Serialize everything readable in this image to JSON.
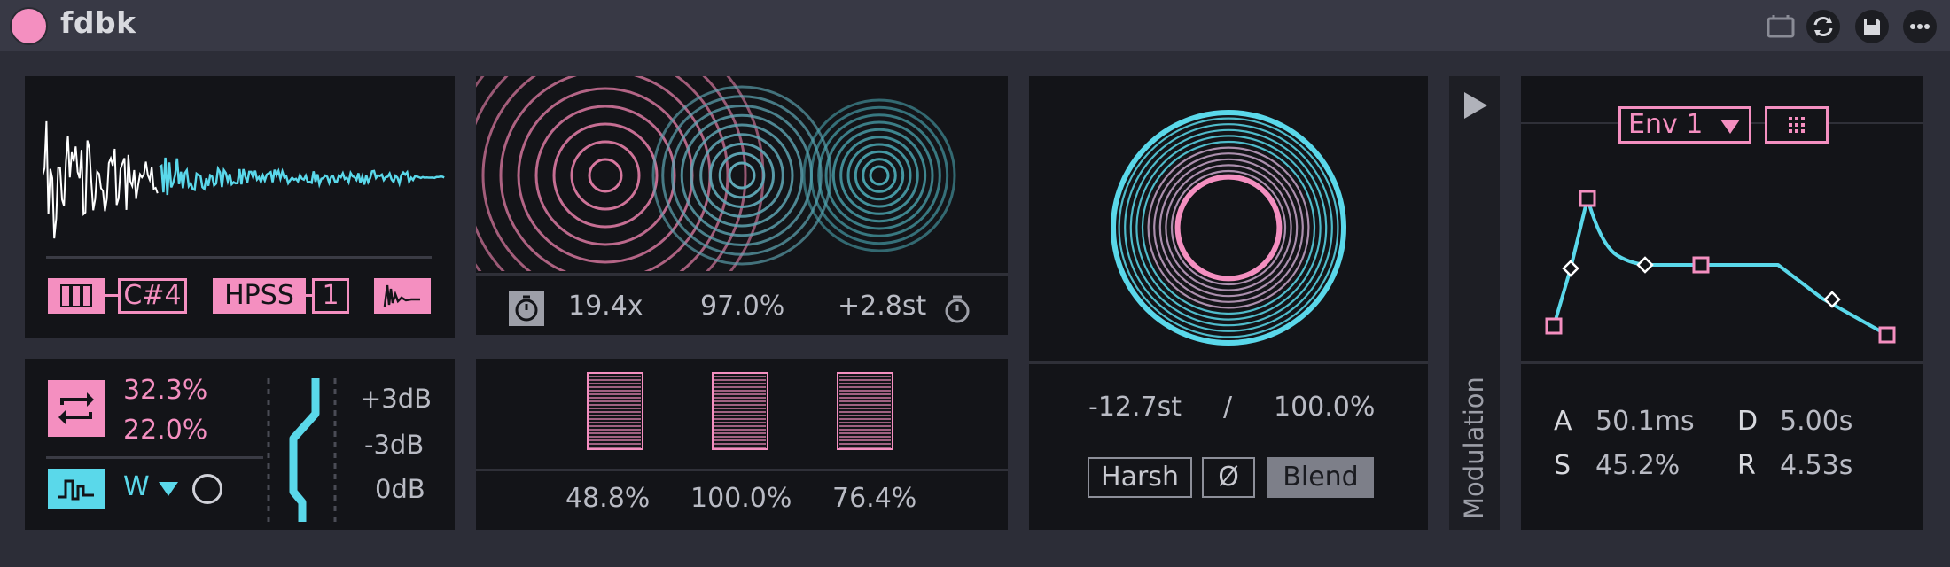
{
  "device": {
    "title": "fdbk"
  },
  "sample": {
    "key_label": "C#4",
    "mode_label": "HPSS",
    "mode_value": "1"
  },
  "freeze": {
    "rate": "32.3%",
    "feedback": "22.0%",
    "wave_label": "W"
  },
  "gain": {
    "high": "+3dB",
    "mid": "-3dB",
    "low": "0dB"
  },
  "rings": {
    "speed": "19.4x",
    "mix": "97.0%",
    "pitch": "+2.8st"
  },
  "bars": {
    "values_text": [
      "48.8%",
      "100.0%",
      "76.4%"
    ],
    "levels": [
      1.0,
      1.0,
      1.0
    ]
  },
  "circle": {
    "pitch": "-12.7st",
    "separator": "/",
    "amount": "100.0%",
    "btn_harsh": "Harsh",
    "btn_phase": "Ø",
    "btn_blend": "Blend"
  },
  "modulation": {
    "label": "Modulation"
  },
  "envelope": {
    "selector": "Env 1",
    "a_label": "A",
    "a_value": "50.1ms",
    "d_label": "D",
    "d_value": "5.00s",
    "s_label": "S",
    "s_value": "45.2%",
    "r_label": "R",
    "r_value": "4.53s"
  },
  "colors": {
    "pink": "#f48fc0",
    "cyan": "#5ad8ea",
    "panel": "#131418",
    "background": "#2c2d37"
  }
}
